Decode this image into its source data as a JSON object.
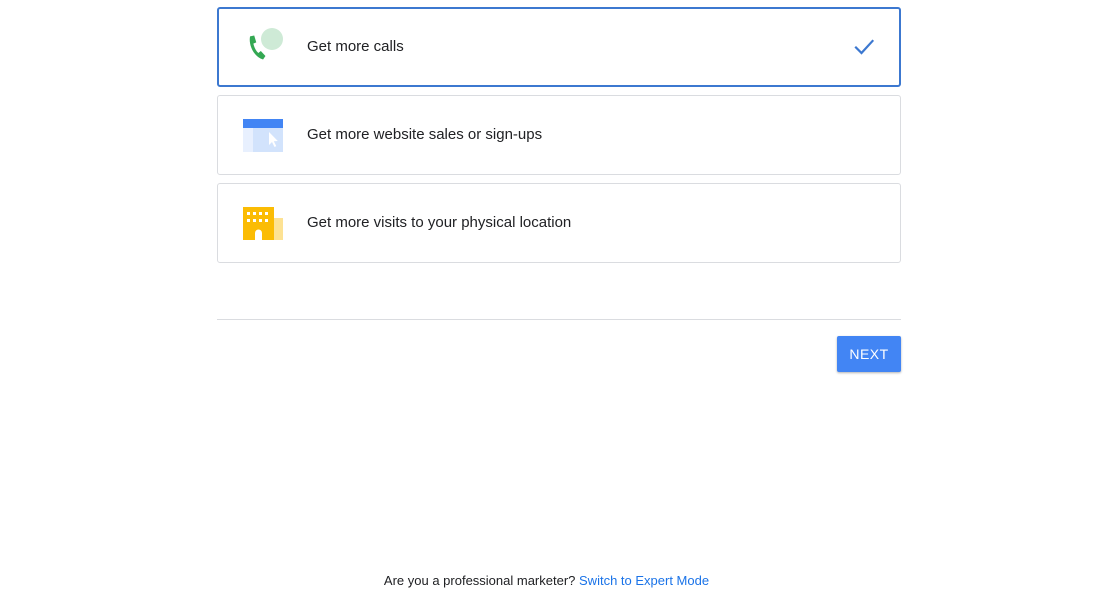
{
  "options": [
    {
      "label": "Get more calls",
      "icon": "phone-chat-icon",
      "selected": true
    },
    {
      "label": "Get more website sales or sign-ups",
      "icon": "browser-window-cursor-icon",
      "selected": false
    },
    {
      "label": "Get more visits to your physical location",
      "icon": "storefront-building-icon",
      "selected": false
    }
  ],
  "actions": {
    "next_label": "NEXT"
  },
  "footer": {
    "question": "Are you a professional marketer?",
    "link_label": "Switch to Expert Mode"
  },
  "colors": {
    "accent": "#4285f4",
    "selected_border": "#3c78d0",
    "link": "#1a73e8",
    "phone_green": "#34a853",
    "building_yellow": "#fbbc04"
  }
}
